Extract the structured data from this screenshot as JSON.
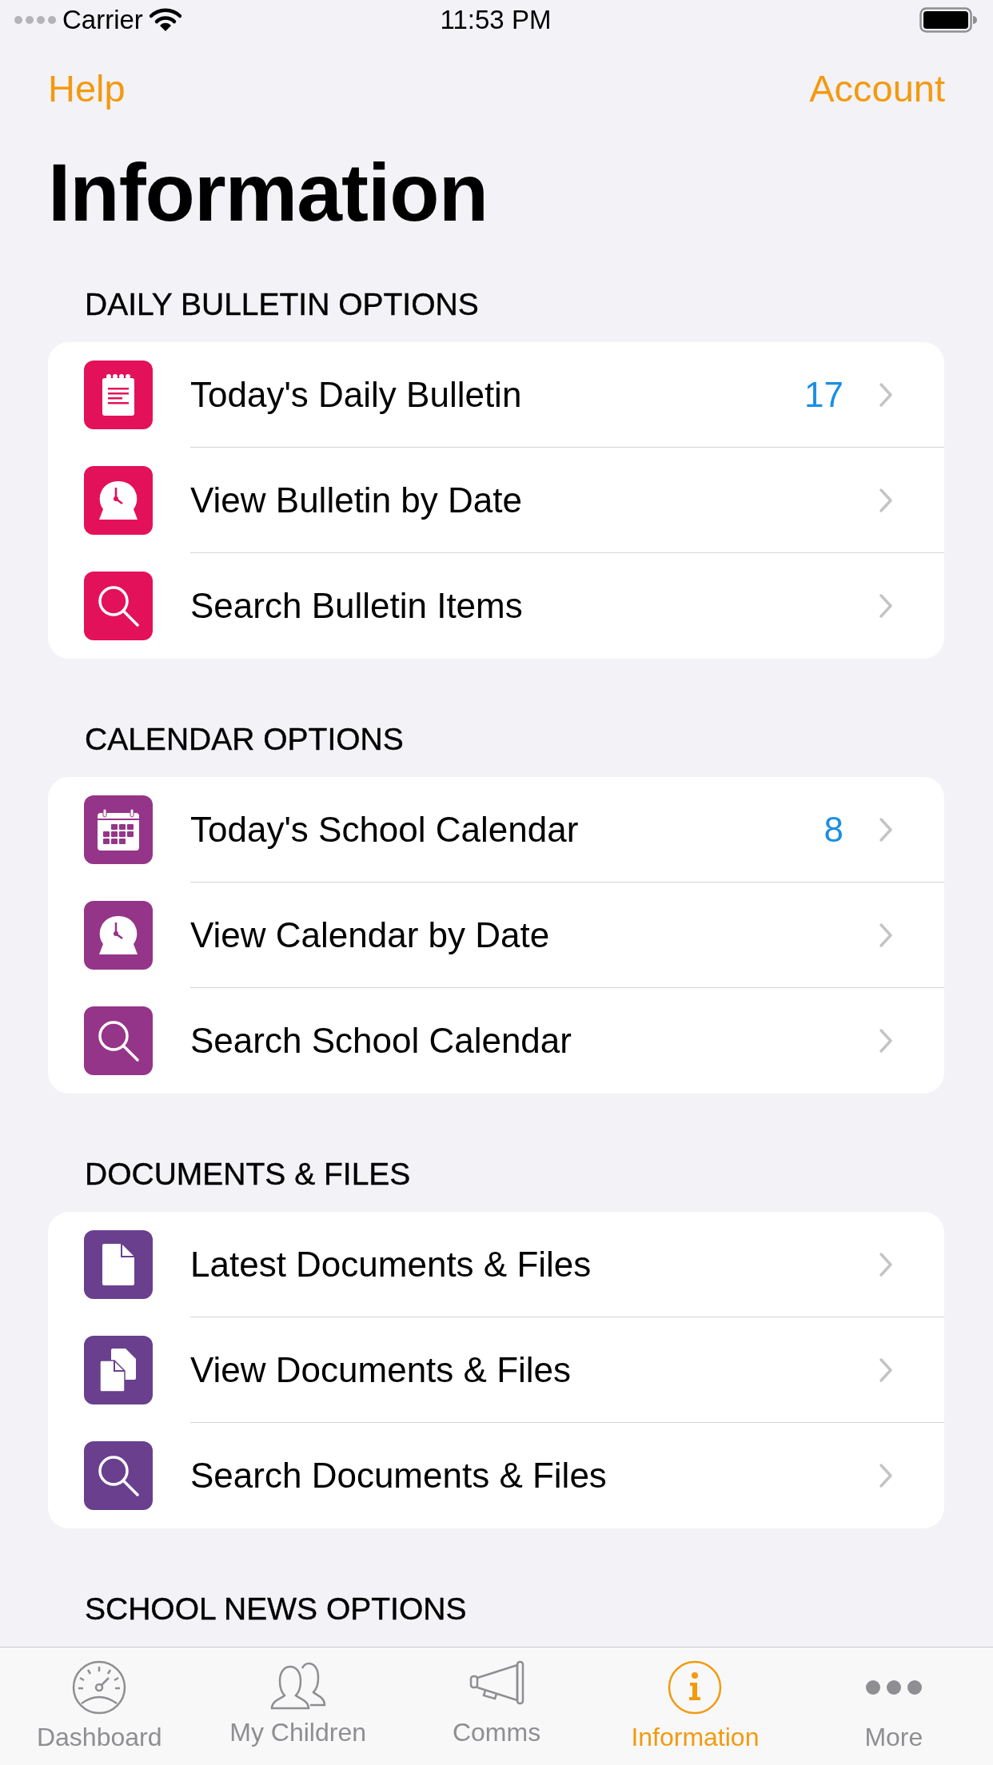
{
  "status_bar": {
    "carrier": "Carrier",
    "time": "11:53 PM"
  },
  "nav": {
    "left": "Help",
    "right": "Account"
  },
  "title": "Information",
  "sections": [
    {
      "header": "DAILY BULLETIN OPTIONS",
      "color": "#e31159",
      "items": [
        {
          "kind": "notepad",
          "label": "Today's Daily Bulletin",
          "badge": "17"
        },
        {
          "kind": "clock",
          "label": "View Bulletin by Date"
        },
        {
          "kind": "search",
          "label": "Search Bulletin Items"
        }
      ]
    },
    {
      "header": "CALENDAR OPTIONS",
      "color": "#953589",
      "items": [
        {
          "kind": "calendar",
          "label": "Today's School Calendar",
          "badge": "8"
        },
        {
          "kind": "clock",
          "label": "View Calendar by Date"
        },
        {
          "kind": "search",
          "label": "Search School Calendar"
        }
      ]
    },
    {
      "header": "DOCUMENTS & FILES",
      "color": "#693f8e",
      "items": [
        {
          "kind": "document",
          "label": "Latest Documents & Files"
        },
        {
          "kind": "documents",
          "label": "View Documents & Files"
        },
        {
          "kind": "search",
          "label": "Search Documents & Files"
        }
      ]
    },
    {
      "header": "SCHOOL NEWS OPTIONS"
    }
  ],
  "tabs": [
    {
      "kind": "gauge",
      "label": "Dashboard",
      "selected": false
    },
    {
      "kind": "people",
      "label": "My Children",
      "selected": false
    },
    {
      "kind": "megaphone",
      "label": "Comms",
      "selected": false
    },
    {
      "kind": "info",
      "label": "Information",
      "selected": true
    },
    {
      "kind": "dots",
      "label": "More",
      "selected": false
    }
  ]
}
